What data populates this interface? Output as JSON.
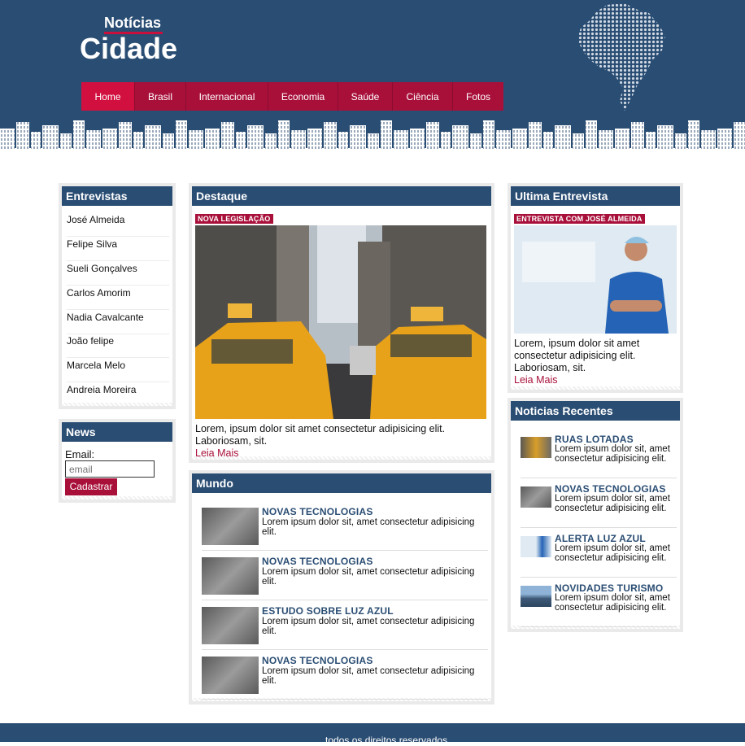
{
  "brand": {
    "small": "Notícias",
    "big": "Cidade"
  },
  "nav": [
    "Home",
    "Brasil",
    "Internacional",
    "Economia",
    "Saúde",
    "Ciência",
    "Fotos"
  ],
  "entrevistas": {
    "title": "Entrevistas",
    "items": [
      "José Almeida",
      "Felipe Silva",
      "Sueli Gonçalves",
      "Carlos Amorim",
      "Nadia Cavalcante",
      "João felipe",
      "Marcela Melo",
      "Andreia Moreira"
    ]
  },
  "news": {
    "title": "News",
    "label": "Email:",
    "placeholder": "email",
    "button": "Cadastrar"
  },
  "destaque": {
    "title": "Destaque",
    "tag": "NOVA LEGISLAÇÃO",
    "text": "Lorem, ipsum dolor sit amet consectetur adipisicing elit. Laboriosam, sit.",
    "more": "Leia Mais"
  },
  "mundo": {
    "title": "Mundo",
    "items": [
      {
        "title": "NOVAS TECNOLOGIAS",
        "text": "Lorem ipsum dolor sit, amet consectetur adipisicing elit."
      },
      {
        "title": "NOVAS TECNOLOGIAS",
        "text": "Lorem ipsum dolor sit, amet consectetur adipisicing elit."
      },
      {
        "title": "ESTUDO SOBRE LUZ AZUL",
        "text": "Lorem ipsum dolor sit, amet consectetur adipisicing elit."
      },
      {
        "title": "NOVAS TECNOLOGIAS",
        "text": "Lorem ipsum dolor sit, amet consectetur adipisicing elit."
      }
    ]
  },
  "ultima": {
    "title": "Ultima Entrevista",
    "tag": "ENTREVISTA COM JOSÉ ALMEIDA",
    "text": "Lorem, ipsum dolor sit amet consectetur adipisicing elit. Laboriosam, sit.",
    "more": "Leia Mais"
  },
  "recentes": {
    "title": "Noticias Recentes",
    "items": [
      {
        "title": "RUAS LOTADAS",
        "text": "Lorem ipsum dolor sit, amet consectetur adipisicing elit."
      },
      {
        "title": "NOVAS TECNOLOGIAS",
        "text": "Lorem ipsum dolor sit, amet consectetur adipisicing elit."
      },
      {
        "title": "ALERTA LUZ AZUL",
        "text": "Lorem ipsum dolor sit, amet consectetur adipisicing elit."
      },
      {
        "title": "NOVIDADES TURISMO",
        "text": "Lorem ipsum dolor sit, amet consectetur adipisicing elit."
      }
    ]
  },
  "footer": "todos os direitos reservados"
}
